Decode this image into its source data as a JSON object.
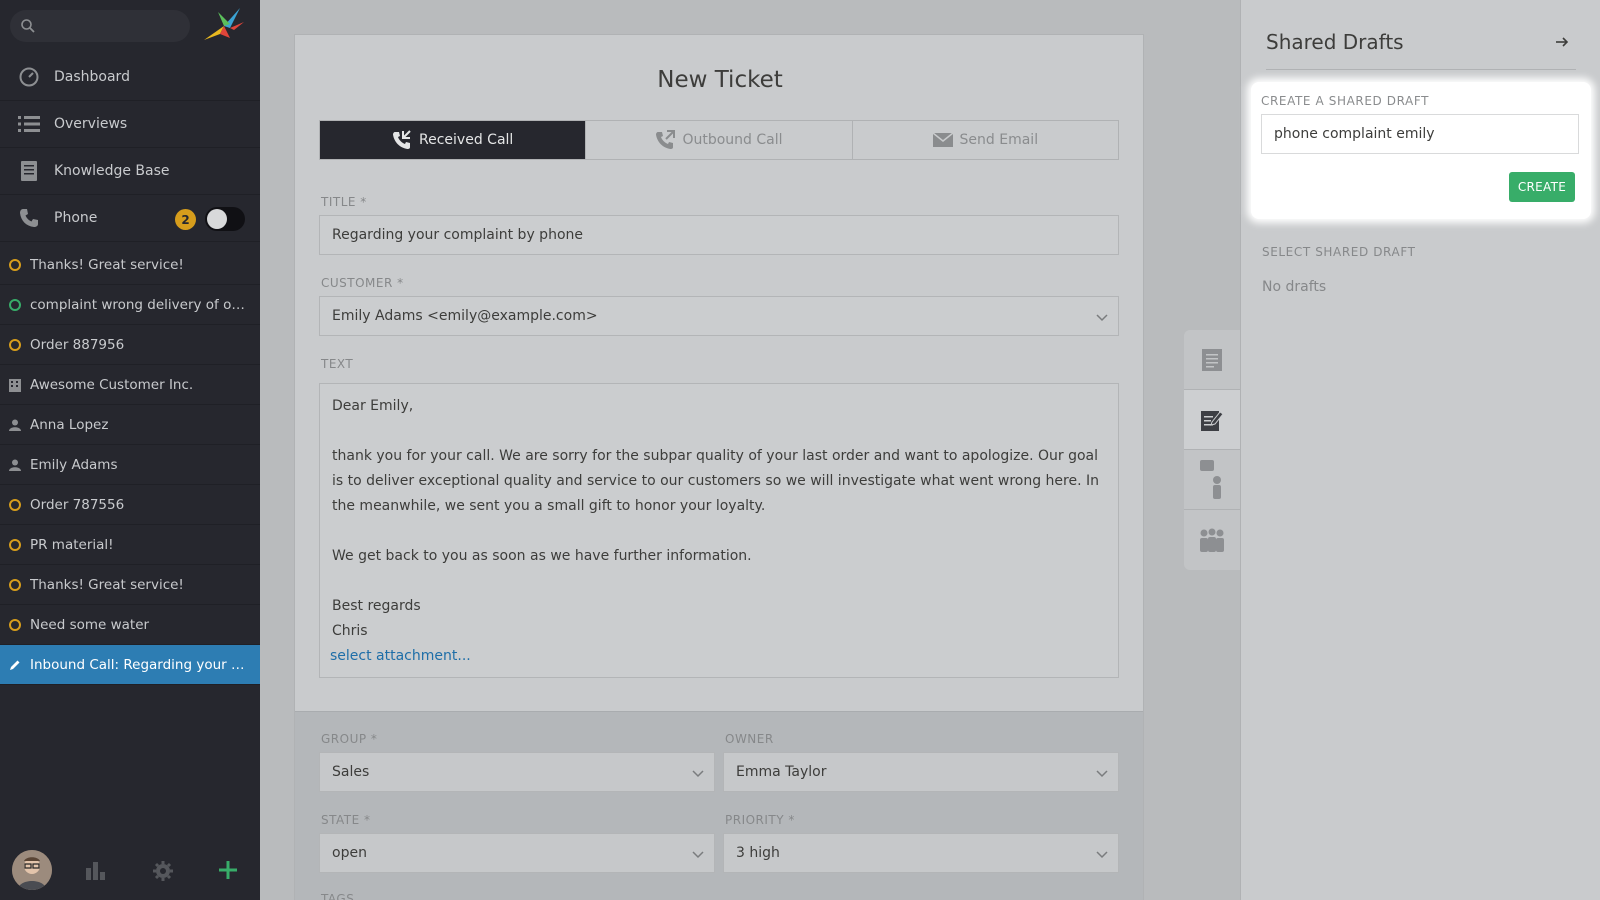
{
  "sidebar": {
    "search_placeholder": "",
    "nav": [
      {
        "label": "Dashboard",
        "icon": "dashboard-icon"
      },
      {
        "label": "Overviews",
        "icon": "list-icon"
      },
      {
        "label": "Knowledge Base",
        "icon": "book-icon"
      },
      {
        "label": "Phone",
        "icon": "phone-icon",
        "badge": "2"
      }
    ],
    "tasks": [
      {
        "label": "Thanks! Great service!",
        "icon": "ticket-open-icon"
      },
      {
        "label": "complaint wrong delivery of ord...",
        "icon": "ticket-new-icon"
      },
      {
        "label": "Order 887956",
        "icon": "ticket-open-icon"
      },
      {
        "label": "Awesome Customer Inc.",
        "icon": "organization-icon"
      },
      {
        "label": "Anna Lopez",
        "icon": "user-icon"
      },
      {
        "label": "Emily Adams",
        "icon": "user-icon"
      },
      {
        "label": "Order 787556",
        "icon": "ticket-open-icon"
      },
      {
        "label": "PR material!",
        "icon": "ticket-open-icon"
      },
      {
        "label": "Thanks! Great service!",
        "icon": "ticket-open-icon"
      },
      {
        "label": "Need some water",
        "icon": "ticket-open-icon"
      },
      {
        "label": "Inbound Call: Regarding your co...",
        "icon": "pen-icon"
      }
    ]
  },
  "ticket": {
    "heading": "New Ticket",
    "tabs": [
      {
        "label": "Received Call",
        "icon": "received-call-icon"
      },
      {
        "label": "Outbound Call",
        "icon": "outbound-call-icon"
      },
      {
        "label": "Send Email",
        "icon": "envelope-icon"
      }
    ],
    "title_label": "TITLE *",
    "title_value": "Regarding your complaint by phone",
    "customer_label": "CUSTOMER *",
    "customer_value": "Emily Adams <emily@example.com>",
    "text_label": "TEXT",
    "text_lines": {
      "greeting": "Dear Emily,",
      "para1": "thank you for your call. We are sorry for the subpar quality of your last order and want to apologize. Our goal is to deliver exceptional quality and service to our customers so we will investigate what went wrong here. In the meanwhile, we sent you a small gift to honor your loyalty.",
      "para2": "We get back to you as soon as we have further information.",
      "closing": "Best regards",
      "signature": "Chris"
    },
    "attachment_link": "select attachment...",
    "group_label": "GROUP *",
    "group_value": "Sales",
    "owner_label": "OWNER",
    "owner_value": "Emma Taylor",
    "state_label": "STATE *",
    "state_value": "open",
    "priority_label": "PRIORITY *",
    "priority_value": "3 high",
    "tags_label": "TAGS"
  },
  "drafts_panel": {
    "title": "Shared Drafts",
    "create_label": "CREATE A SHARED DRAFT",
    "draft_name_value": "phone complaint emily",
    "create_button": "CREATE",
    "select_label": "SELECT SHARED DRAFT",
    "empty_text": "No drafts"
  },
  "colors": {
    "accent_green": "#38ad69",
    "active_blue": "#2d7db3",
    "badge_yellow": "#d69d1c",
    "sidebar_bg": "#26272e"
  }
}
